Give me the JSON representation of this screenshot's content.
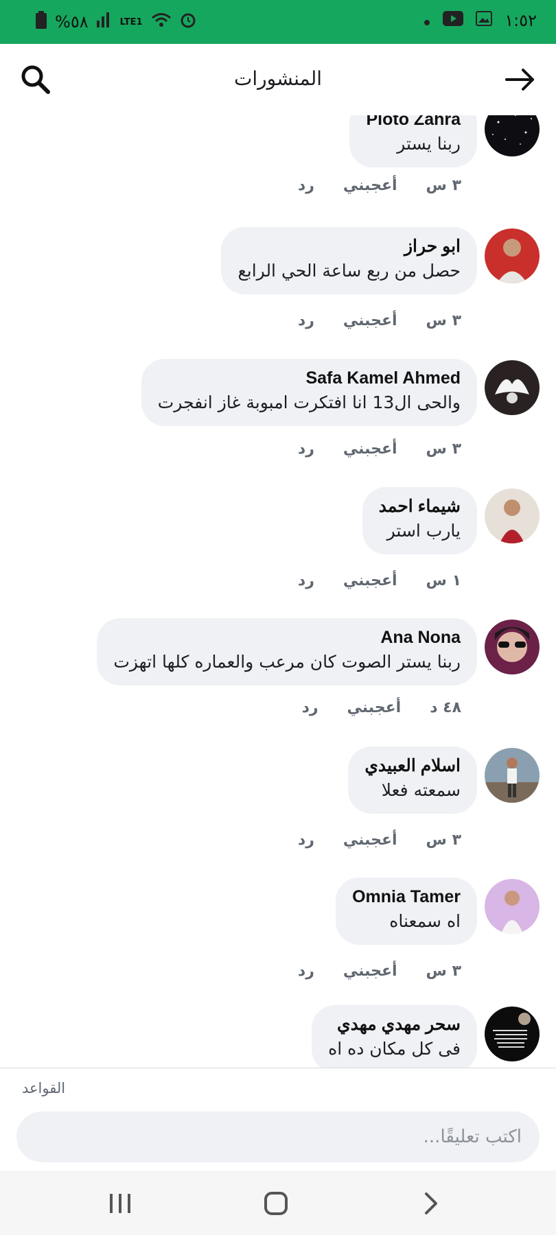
{
  "status_bar": {
    "battery": "%٥٨",
    "network": "LTE1",
    "time": "١:٥٢"
  },
  "header": {
    "title": "المنشورات"
  },
  "comments": [
    {
      "name": "Ploto Zahra",
      "text": "ربنا يستر",
      "time": "٣ س",
      "like": "أعجبني",
      "reply": "رد"
    },
    {
      "name": "ابو حراز",
      "text": "حصل من ربع ساعة الحي الرابع",
      "time": "٣ س",
      "like": "أعجبني",
      "reply": "رد"
    },
    {
      "name": "Safa Kamel Ahmed",
      "text": "والحى ال13  انا افتكرت امبوبة غاز انفجرت",
      "time": "٣ س",
      "like": "أعجبني",
      "reply": "رد"
    },
    {
      "name": "شيماء احمد",
      "text": "يارب استر",
      "time": "١ س",
      "like": "أعجبني",
      "reply": "رد"
    },
    {
      "name": "Ana Nona",
      "text": "ربنا يستر الصوت كان مرعب والعماره كلها اتهزت",
      "time": "٤٨ د",
      "like": "أعجبني",
      "reply": "رد"
    },
    {
      "name": "اسلام العبيدي",
      "text": "سمعته فعلا",
      "time": "٣ س",
      "like": "أعجبني",
      "reply": "رد"
    },
    {
      "name": "Omnia Tamer",
      "text": "اه سمعناه",
      "time": "٣ س",
      "like": "أعجبني",
      "reply": "رد"
    },
    {
      "name": "سحر مهدي مهدي",
      "text": "فى كل مكان ده اه",
      "time": "",
      "like": "",
      "reply": ""
    }
  ],
  "footer": {
    "rules_label": "القواعد",
    "comment_placeholder": "اكتب تعليقًا..."
  },
  "colors": {
    "status_bar": "#16a75e",
    "bubble": "#f0f1f5"
  }
}
